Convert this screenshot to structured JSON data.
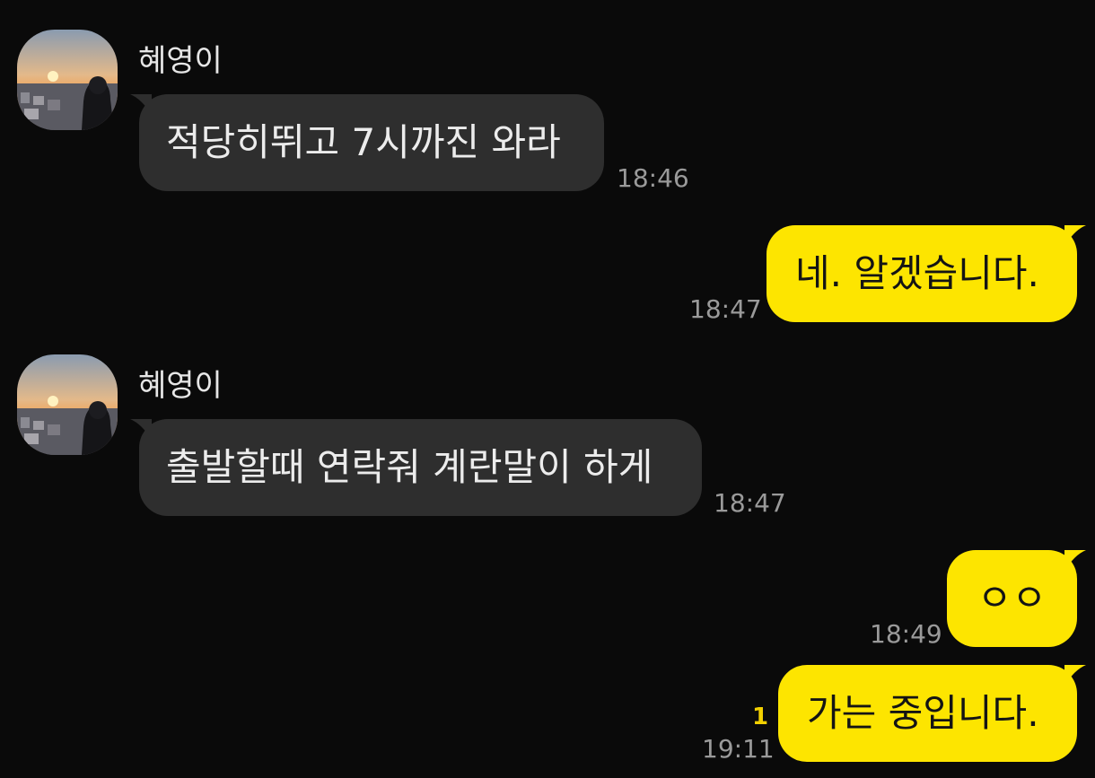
{
  "chat": {
    "messages": [
      {
        "sender": "혜영이",
        "text": "적당히뛰고 7시까진 와라",
        "time": "18:46"
      },
      {
        "text": "네. 알겠습니다.",
        "time": "18:47"
      },
      {
        "sender": "혜영이",
        "text": "출발할때 연락줘 계란말이 하게",
        "time": "18:47"
      },
      {
        "text": "ㅇㅇ",
        "time": "18:49"
      },
      {
        "text": "가는 중입니다.",
        "time": "19:11",
        "unread": "1"
      }
    ]
  },
  "colors": {
    "background": "#0a0a0a",
    "incoming_bubble": "#2e2e2e",
    "outgoing_bubble": "#fde500",
    "unread_count": "#f2d000"
  }
}
